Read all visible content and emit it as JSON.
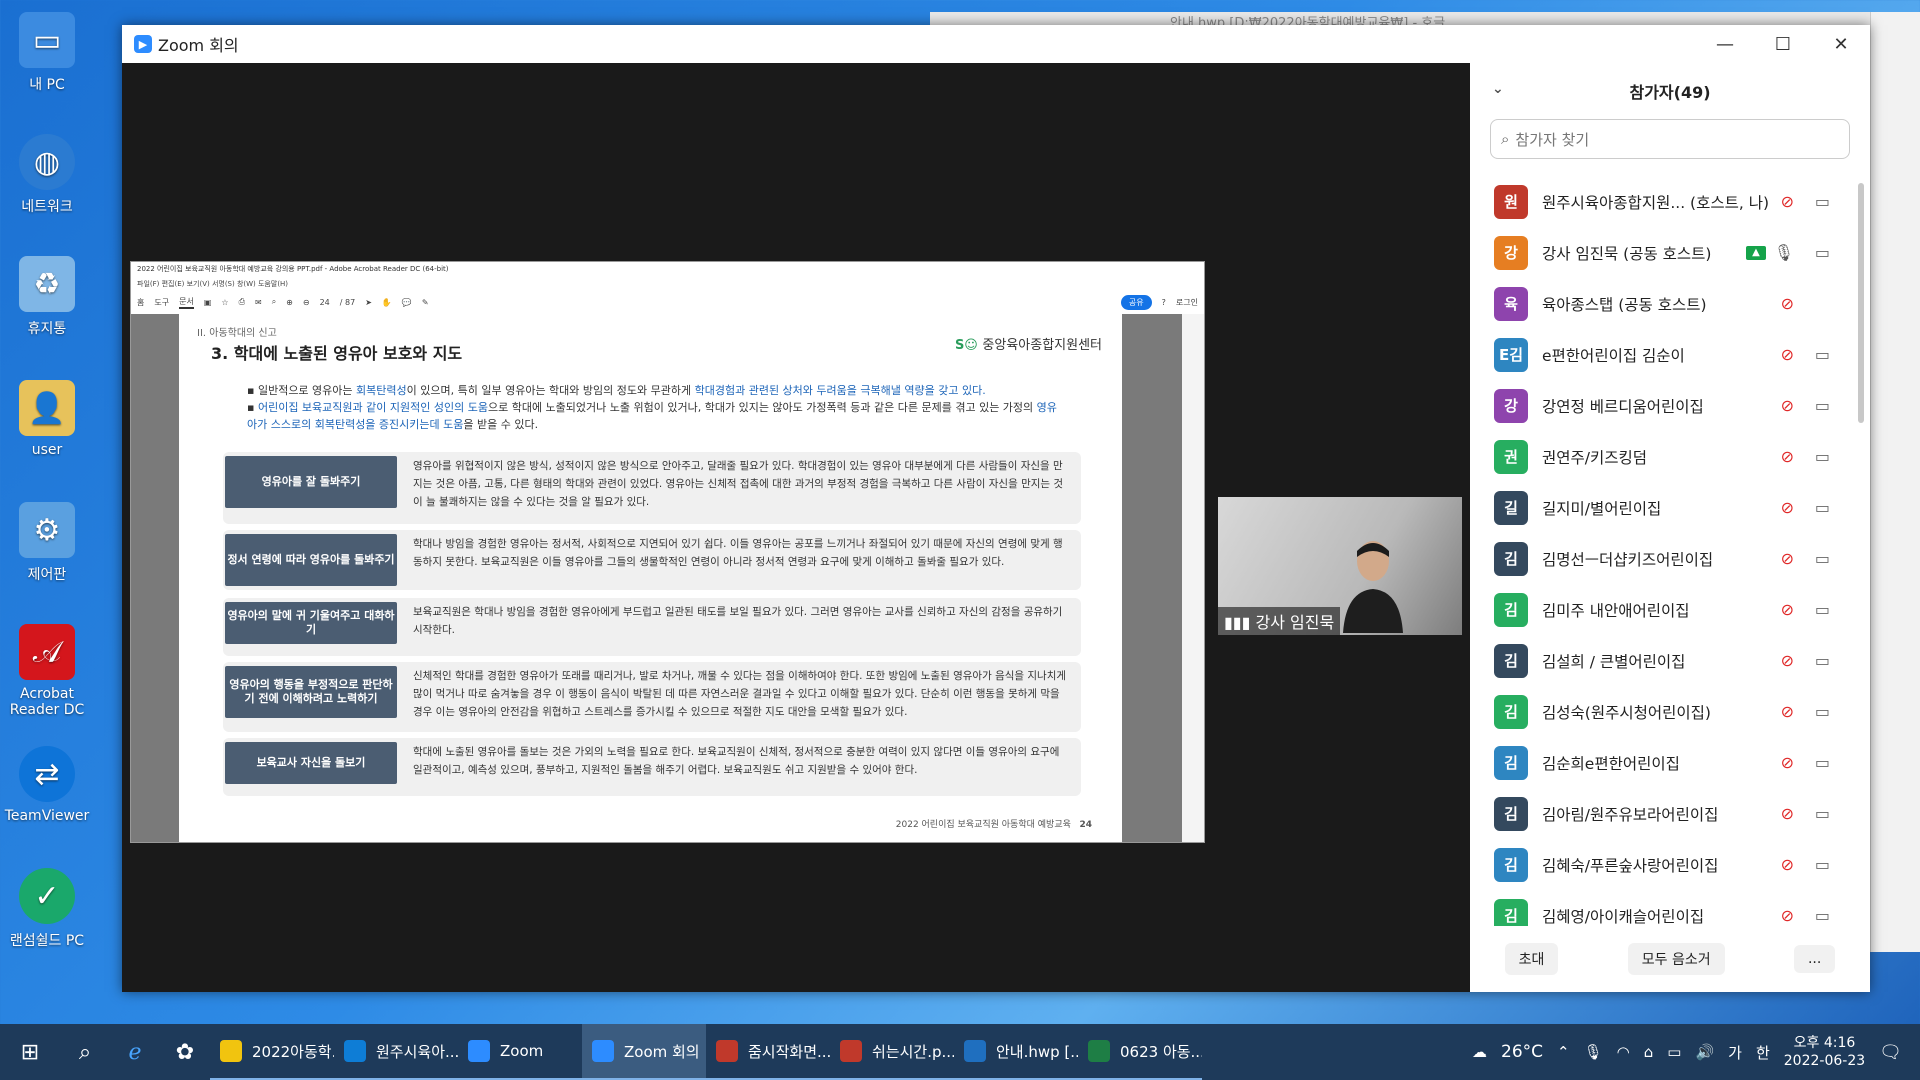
{
  "desktop": {
    "icons": [
      {
        "label": "내 PC"
      },
      {
        "label": "네트워크"
      },
      {
        "label": "휴지통"
      },
      {
        "label": "user"
      },
      {
        "label": "제어판"
      },
      {
        "label": "Acrobat Reader DC"
      },
      {
        "label": "TeamViewer"
      },
      {
        "label": "랜섬쉴드 PC"
      }
    ],
    "bg_window_title": "안내.hwp [D:₩2022아동학대예방교육₩] - 호글"
  },
  "zoom": {
    "title": "Zoom 회의",
    "shared_window": {
      "title": "2022 어린이집 보육교직원 아동학대 예방교육 강의용 PPT.pdf - Adobe Acrobat Reader DC (64-bit)",
      "menu": "파일(F)  편집(E)  보기(V)  서명(S)  창(W)  도움말(H)",
      "toolbar": {
        "home": "홈",
        "tools": "도구",
        "doc": "문서",
        "page": "24",
        "page_total": "/ 87",
        "share": "공유",
        "login": "로그인"
      },
      "page": {
        "section": "II. 아동학대의 신고",
        "title": "3. 학대에 노출된 영유아 보호와 지도",
        "logo": "중앙육아종합지원센터",
        "bullet1_pre": "일반적으로 영유아는 ",
        "bullet1_hl": "회복탄력성",
        "bullet1_mid": "이 있으며, 특히 일부 영유아는 학대와 방임의 정도와 무관하게 ",
        "bullet1_hl2": "학대경험과 관련된 상처와 두려움을 극복해낼 역량을 갖고 있다.",
        "bullet2_hl": "어린이집 보육교직원과 같이 지원적인 성인의 도움",
        "bullet2_mid": "으로 학대에 노출되었거나 노출 위험이 있거나, 학대가 있지는 않아도 가정폭력 등과 같은 다른 문제를 겪고 있는 가정의 ",
        "bullet2_hl2": "영유아가 스스로의 회복탄력성을 증진시키는데 도움",
        "bullet2_end": "을 받을 수 있다.",
        "rows": [
          {
            "label": "영유아를 잘 돌봐주기",
            "text": "영유아를 위협적이지 않은 방식, 성적이지 않은 방식으로 안아주고, 달래줄 필요가 있다. 학대경험이 있는 영유아 대부분에게 다른 사람들이 자신을 만지는 것은 아픔, 고통, 다른 형태의 학대와 관련이 있었다. 영유아는 신체적 접촉에 대한 과거의 부정적 경험을 극복하고 다른 사람이 자신을 만지는 것이 늘 불쾌하지는 않을 수 있다는 것을 알 필요가 있다."
          },
          {
            "label": "정서 연령에 따라 영유아를 돌봐주기",
            "text": "학대나 방임을 경험한 영유아는 정서적, 사회적으로 지연되어 있기 쉽다. 이들 영유아는 공포를 느끼거나 좌절되어 있기 때문에 자신의 연령에 맞게 행동하지 못한다. 보육교직원은 이들 영유아를 그들의 생물학적인 연령이 아니라 정서적 연령과 요구에 맞게 이해하고 돌봐줄 필요가 있다."
          },
          {
            "label": "영유아의 말에 귀 기울여주고 대화하기",
            "text": "보육교직원은 학대나 방임을 경험한 영유아에게 부드럽고 일관된 태도를 보일 필요가 있다. 그러면 영유아는 교사를 신뢰하고 자신의 감정을 공유하기 시작한다."
          },
          {
            "label": "영유아의 행동을 부정적으로 판단하기 전에 이해하려고 노력하기",
            "text": "신체적인 학대를 경험한 영유아가 또래를 때리거나, 발로 차거나, 깨물 수 있다는 점을 이해하여야 한다. 또한 방임에 노출된 영유아가 음식을 지나치게 많이 먹거나 따로 숨겨놓을 경우 이 행동이 음식이 박탈된 데 따른 자연스러운 결과일 수 있다고 이해할 필요가 있다. 단순히 이런 행동을 못하게 막을 경우 이는 영유아의 안전감을 위협하고 스트레스를 증가시킬 수 있으므로 적절한 지도 대안을 모색할 필요가 있다."
          },
          {
            "label": "보육교사 자신을 돌보기",
            "text": "학대에 노출된 영유아를 돌보는 것은 가외의 노력을 필요로 한다. 보육교직원이 신체적, 정서적으로 충분한 여력이 있지 않다면 이들 영유아의 요구에 일관적이고, 예측성 있으며, 풍부하고, 지원적인 돌봄을 해주기 어렵다. 보육교직원도 쉬고 지원받을 수 있어야 한다."
          }
        ],
        "footer": "2022 어린이집 보육교직원 아동학대 예방교육",
        "page_num": "24"
      }
    },
    "video": {
      "name": "강사 임진묵"
    },
    "participants": {
      "header": "참가자(49)",
      "search_placeholder": "참가자 찾기",
      "list": [
        {
          "initial": "원",
          "name": "원주시육아종합지원... (호스트, 나)",
          "color": "#c0392b",
          "mic": "off",
          "share": false
        },
        {
          "initial": "강",
          "name": "강사 임진묵 (공동 호스트)",
          "color": "#e67e22",
          "mic": "on",
          "share": true
        },
        {
          "initial": "육",
          "name": "육아종스탭 (공동 호스트)",
          "color": "#8e44ad",
          "mic": "off",
          "share": false,
          "nocam": true
        },
        {
          "initial": "E김",
          "name": "e편한어린이집 김순이",
          "color": "#2e86c1",
          "mic": "off",
          "share": false
        },
        {
          "initial": "강",
          "name": "강연정 베르디움어린이집",
          "color": "#8e44ad",
          "mic": "off",
          "share": false
        },
        {
          "initial": "권",
          "name": "권연주/키즈킹덤",
          "color": "#27ae60",
          "mic": "off",
          "share": false
        },
        {
          "initial": "길",
          "name": "길지미/별어린이집",
          "color": "#34495e",
          "mic": "off",
          "share": false
        },
        {
          "initial": "김",
          "name": "김명선ㅡ더샵키즈어린이집",
          "color": "#34495e",
          "mic": "off",
          "share": false
        },
        {
          "initial": "김",
          "name": "김미주 내안애어린이집",
          "color": "#27ae60",
          "mic": "off",
          "share": false
        },
        {
          "initial": "김",
          "name": "김설희 / 큰별어린이집",
          "color": "#34495e",
          "mic": "off",
          "share": false
        },
        {
          "initial": "김",
          "name": "김성숙(원주시청어린이집)",
          "color": "#27ae60",
          "mic": "off",
          "share": false
        },
        {
          "initial": "김",
          "name": "김순희e편한어린이집",
          "color": "#2e86c1",
          "mic": "off",
          "share": false
        },
        {
          "initial": "김",
          "name": "김아림/원주유보라어린이집",
          "color": "#34495e",
          "mic": "off",
          "share": false
        },
        {
          "initial": "김",
          "name": "김혜숙/푸른숲사랑어린이집",
          "color": "#2e86c1",
          "mic": "off",
          "share": false
        },
        {
          "initial": "김",
          "name": "김혜영/아이캐슬어린이집",
          "color": "#27ae60",
          "mic": "off",
          "share": false
        }
      ],
      "footer": {
        "invite": "초대",
        "mute_all": "모두 음소거",
        "more": "..."
      }
    }
  },
  "taskbar": {
    "tasks": [
      {
        "label": "2022아동학...",
        "color": "#f1c40f"
      },
      {
        "label": "원주시육아...",
        "color": "#0e7dd6"
      },
      {
        "label": "Zoom",
        "color": "#2d8cff"
      },
      {
        "label": "Zoom 회의",
        "color": "#2d8cff"
      },
      {
        "label": "줌시작화면...",
        "color": "#c0392b"
      },
      {
        "label": "쉬는시간.p...",
        "color": "#c0392b"
      },
      {
        "label": "안내.hwp [...",
        "color": "#1f6fbf"
      },
      {
        "label": "0623 아동...",
        "color": "#1e7e45"
      }
    ],
    "weather": "26°C",
    "ime": "가",
    "ime2": "한",
    "time": "오후 4:16",
    "date": "2022-06-23"
  }
}
